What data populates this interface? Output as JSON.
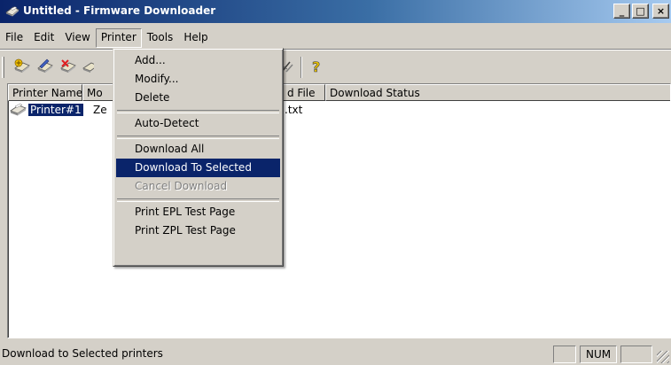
{
  "window": {
    "title": "Untitled - Firmware Downloader",
    "controls": {
      "minimize": "_",
      "maximize": "□",
      "close": "×"
    }
  },
  "menubar": {
    "items": [
      {
        "label": "File"
      },
      {
        "label": "Edit"
      },
      {
        "label": "View"
      },
      {
        "label": "Printer",
        "open": true
      },
      {
        "label": "Tools"
      },
      {
        "label": "Help"
      }
    ]
  },
  "toolbar": {
    "buttons": [
      {
        "icon": "add-printer-icon"
      },
      {
        "icon": "modify-printer-icon"
      },
      {
        "icon": "delete-printer-icon"
      },
      {
        "icon": "printer-icon"
      },
      {
        "icon": "download-icon"
      },
      {
        "icon": "help-question-icon"
      }
    ]
  },
  "printer_menu": {
    "items": [
      {
        "label": "Add...",
        "state": "normal"
      },
      {
        "label": "Modify...",
        "state": "normal"
      },
      {
        "label": "Delete",
        "state": "normal"
      },
      {
        "separator": true
      },
      {
        "label": "Auto-Detect",
        "state": "normal"
      },
      {
        "separator": true
      },
      {
        "label": "Download All",
        "state": "normal"
      },
      {
        "label": "Download To Selected",
        "state": "selected"
      },
      {
        "label": "Cancel Download",
        "state": "disabled"
      },
      {
        "separator": true
      },
      {
        "label": "Print EPL Test Page",
        "state": "normal"
      },
      {
        "label": "Print ZPL Test Page",
        "state": "normal"
      }
    ]
  },
  "list": {
    "columns": [
      {
        "label": "Printer Name"
      },
      {
        "label": "Mo"
      },
      {
        "label": "d File"
      },
      {
        "label": "Download Status"
      }
    ],
    "rows": [
      {
        "name": "Printer#1",
        "model": "Ze",
        "file": ".txt",
        "status": ""
      }
    ]
  },
  "statusbar": {
    "text": "Download to Selected printers",
    "num_indicator": "NUM"
  },
  "colors": {
    "selection": "#0a246a",
    "face": "#d4d0c8",
    "titlebar_start": "#0a246a",
    "titlebar_end": "#a6caf0"
  }
}
